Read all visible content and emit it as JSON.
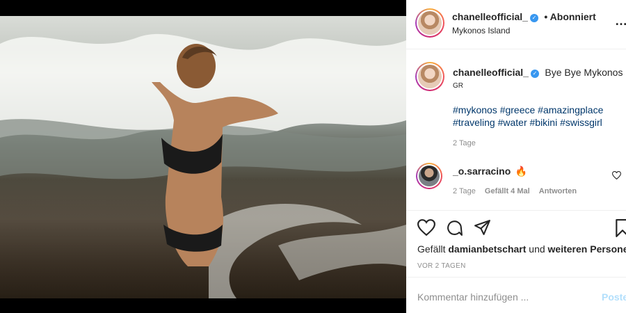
{
  "header": {
    "username": "chanelleofficial_",
    "follow_status": "• Abonniert",
    "location": "Mykonos Island",
    "more_icon": "more-horizontal-icon"
  },
  "caption": {
    "username": "chanelleofficial_",
    "text": "Bye Bye Mykonos",
    "subtext": "GR",
    "hashtags_line1": "#mykonos #greece #amazingplace",
    "hashtags_line2": "#traveling #water #bikini #swissgirl",
    "time": "2 Tage"
  },
  "comment": {
    "username": "_o.sarracino",
    "emoji": "🔥",
    "time": "2 Tage",
    "likes": "Gefällt 4 Mal",
    "reply": "Antworten"
  },
  "actions": {
    "like_icon": "heart-icon",
    "comment_icon": "comment-icon",
    "share_icon": "share-icon",
    "save_icon": "bookmark-icon"
  },
  "likes_line": {
    "prefix": "Gefällt",
    "user": "damianbetschart",
    "connector": "und",
    "others": "weiteren Personen"
  },
  "posted": "VOR 2 TAGEN",
  "add_comment": {
    "placeholder": "Kommentar hinzufügen ...",
    "post_label": "Posten"
  },
  "colors": {
    "link": "#00376b",
    "verified": "#3897f0",
    "muted": "#8e8e8e",
    "post_disabled": "#b2dffc"
  }
}
